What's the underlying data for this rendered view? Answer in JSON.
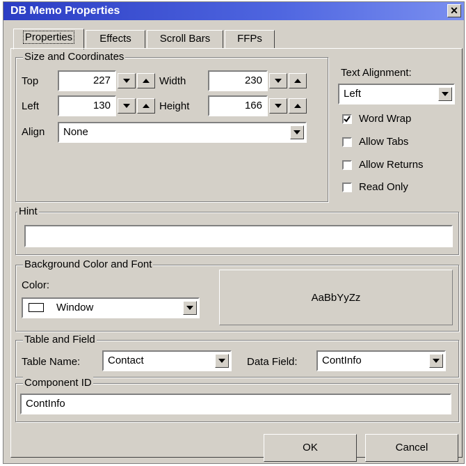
{
  "window": {
    "title": "DB Memo Properties",
    "close_glyph": "✕"
  },
  "tabs": [
    {
      "label": "Properties",
      "active": true
    },
    {
      "label": "Effects",
      "active": false
    },
    {
      "label": "Scroll Bars",
      "active": false
    },
    {
      "label": "FFPs",
      "active": false
    }
  ],
  "size_coords": {
    "legend": "Size and Coordinates",
    "top_label": "Top",
    "top_value": "227",
    "width_label": "Width",
    "width_value": "230",
    "left_label": "Left",
    "left_value": "130",
    "height_label": "Height",
    "height_value": "166",
    "align_label": "Align",
    "align_value": "None"
  },
  "text_alignment": {
    "label": "Text Alignment:",
    "value": "Left",
    "word_wrap": {
      "label": "Word Wrap",
      "checked": true
    },
    "allow_tabs": {
      "label": "Allow Tabs",
      "checked": false
    },
    "allow_returns": {
      "label": "Allow Returns",
      "checked": false
    },
    "read_only": {
      "label": "Read Only",
      "checked": false
    }
  },
  "hint": {
    "legend": "Hint",
    "value": ""
  },
  "background": {
    "legend": "Background Color and Font",
    "color_label": "Color:",
    "color_value": "Window",
    "font_preview": "AaBbYyZz"
  },
  "table_field": {
    "legend": "Table and Field",
    "table_label": "Table Name:",
    "table_value": "Contact",
    "data_label": "Data Field:",
    "data_value": "ContInfo"
  },
  "component": {
    "legend": "Component ID",
    "value": "ContInfo"
  },
  "buttons": {
    "ok": "OK",
    "cancel": "Cancel"
  }
}
